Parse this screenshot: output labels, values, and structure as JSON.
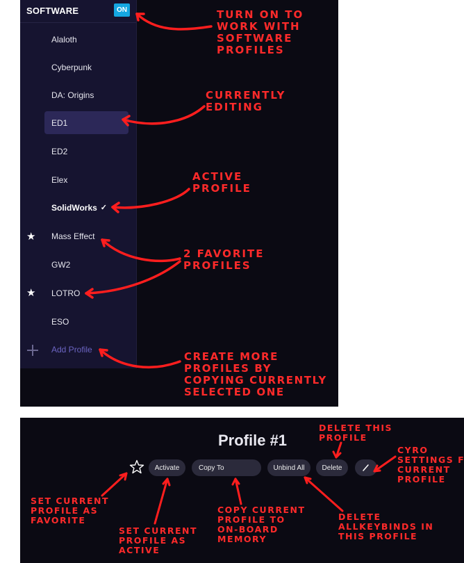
{
  "sidebar": {
    "title": "SOFTWARE",
    "toggle_label": "ON",
    "items": [
      {
        "label": "Alaloth"
      },
      {
        "label": "Cyberpunk"
      },
      {
        "label": "DA: Origins"
      },
      {
        "label": "ED1",
        "editing": true
      },
      {
        "label": "ED2"
      },
      {
        "label": "Elex"
      },
      {
        "label": "SolidWorks",
        "active": true
      },
      {
        "label": "Mass Effect",
        "favorite": true
      },
      {
        "label": "GW2"
      },
      {
        "label": "LOTRO",
        "favorite": true
      },
      {
        "label": "ESO"
      }
    ],
    "check_glyph": "✓",
    "star_glyph": "★",
    "add_label": "Add Profile"
  },
  "annotations_top": {
    "toggle": [
      "TURN ON TO",
      "WORK WITH",
      "SOFTWARE",
      "PROFILES"
    ],
    "editing": [
      "CURRENTLY",
      "EDITING"
    ],
    "active": [
      "ACTIVE",
      "PROFILE"
    ],
    "favorites": [
      "2 FAVORITE",
      "PROFILES"
    ],
    "create": [
      "CREATE MORE",
      "PROFILES BY",
      "COPYING CURRENTLY",
      "SELECTED ONE"
    ]
  },
  "profile": {
    "title": "Profile #1",
    "buttons": {
      "activate": "Activate",
      "copy_to": "Copy To",
      "unbind_all": "Unbind All",
      "delete": "Delete"
    }
  },
  "annotations_bottom": {
    "delete": [
      "DELETE THIS",
      "PROFILE"
    ],
    "cyro": [
      "CYRO",
      "SETTINGS FOR",
      "CURRENT",
      "PROFILE"
    ],
    "favorite": [
      "SET CURRENT",
      "PROFILE AS",
      "FAVORITE"
    ],
    "active": [
      "SET CURRENT",
      "PROFILE AS",
      "ACTIVE"
    ],
    "copy": [
      "COPY CURRENT",
      "PROFILE TO",
      "ON-BOARD",
      "MEMORY"
    ],
    "unbind": [
      "DELETE",
      "ALLKEYBINDS IN",
      "THIS PROFILE"
    ]
  },
  "colors": {
    "annotation": "#ff2a2a",
    "toggle": "#15a7e2",
    "sidebar": "#161430",
    "editing_highlight": "#2c2858",
    "background": "#0b0a13"
  }
}
